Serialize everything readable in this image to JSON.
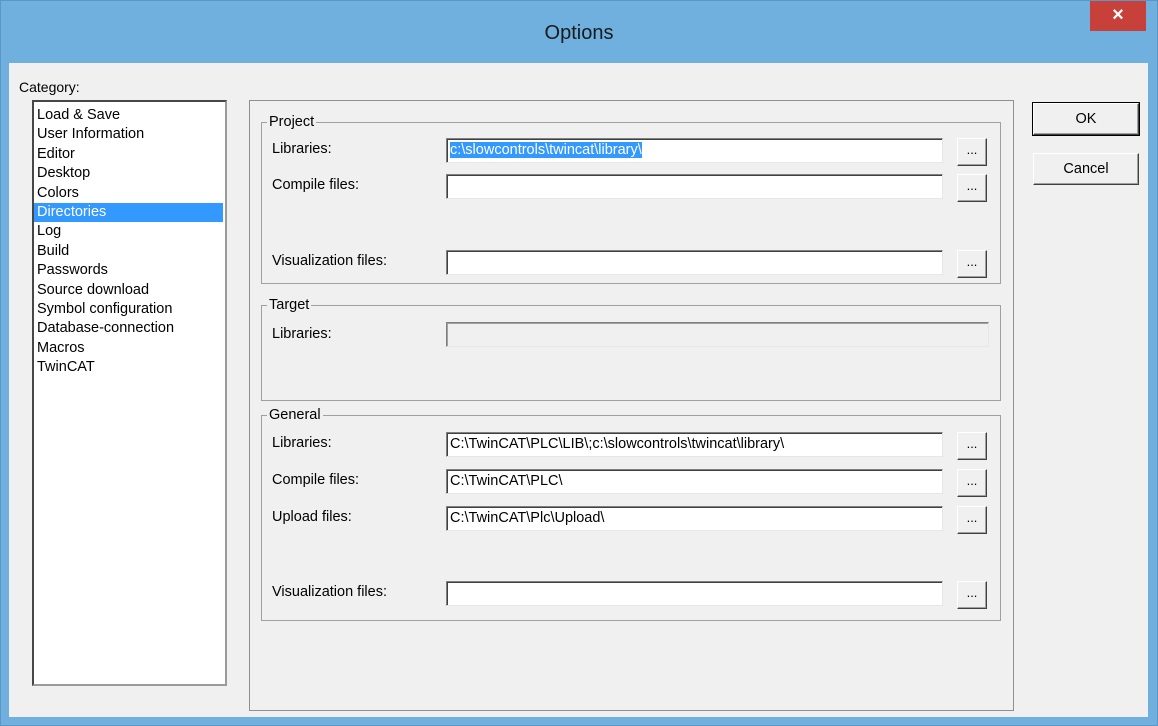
{
  "window": {
    "title": "Options",
    "close_glyph": "×"
  },
  "category": {
    "label": "Category:",
    "items": [
      "Load & Save",
      "User Information",
      "Editor",
      "Desktop",
      "Colors",
      "Directories",
      "Log",
      "Build",
      "Passwords",
      "Source download",
      "Symbol configuration",
      "Database-connection",
      "Macros",
      "TwinCAT"
    ],
    "selected": "Directories"
  },
  "project": {
    "legend": "Project",
    "libraries_label": "Libraries:",
    "libraries_value": "c:\\slowcontrols\\twincat\\library\\",
    "compile_label": "Compile files:",
    "compile_value": "",
    "visualization_label": "Visualization files:",
    "visualization_value": ""
  },
  "target": {
    "legend": "Target",
    "libraries_label": "Libraries:",
    "libraries_value": ""
  },
  "general": {
    "legend": "General",
    "libraries_label": "Libraries:",
    "libraries_value": "C:\\TwinCAT\\PLC\\LIB\\;c:\\slowcontrols\\twincat\\library\\",
    "compile_label": "Compile files:",
    "compile_value": "C:\\TwinCAT\\PLC\\",
    "upload_label": "Upload files:",
    "upload_value": "C:\\TwinCAT\\Plc\\Upload\\",
    "visualization_label": "Visualization files:",
    "visualization_value": ""
  },
  "browse_label": "...",
  "buttons": {
    "ok": "OK",
    "cancel": "Cancel"
  }
}
